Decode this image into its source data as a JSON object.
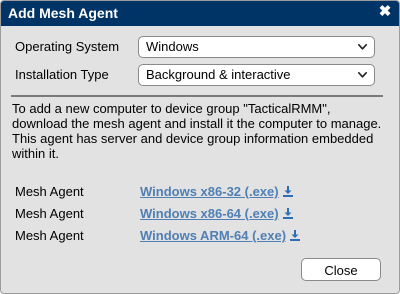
{
  "dialog": {
    "title": "Add Mesh Agent",
    "close_icon": "close-x-icon",
    "close_glyph": "✖"
  },
  "form": {
    "os": {
      "label": "Operating System",
      "value": "Windows"
    },
    "install_type": {
      "label": "Installation Type",
      "value": "Background & interactive"
    }
  },
  "description": "To add a new computer to device group \"TacticalRMM\", download the mesh agent and install it the computer to manage. This agent has server and device group information embedded within it.",
  "agents": [
    {
      "label": "Mesh Agent",
      "link": "Windows x86-32 (.exe)"
    },
    {
      "label": "Mesh Agent",
      "link": "Windows x86-64 (.exe)"
    },
    {
      "label": "Mesh Agent",
      "link": "Windows ARM-64 (.exe)"
    }
  ],
  "buttons": {
    "close": "Close"
  },
  "colors": {
    "titlebar": "#036",
    "dialog_bg": "#e2e2e2",
    "link": "#4f7fb4",
    "download_icon": "#2d6fb5"
  }
}
